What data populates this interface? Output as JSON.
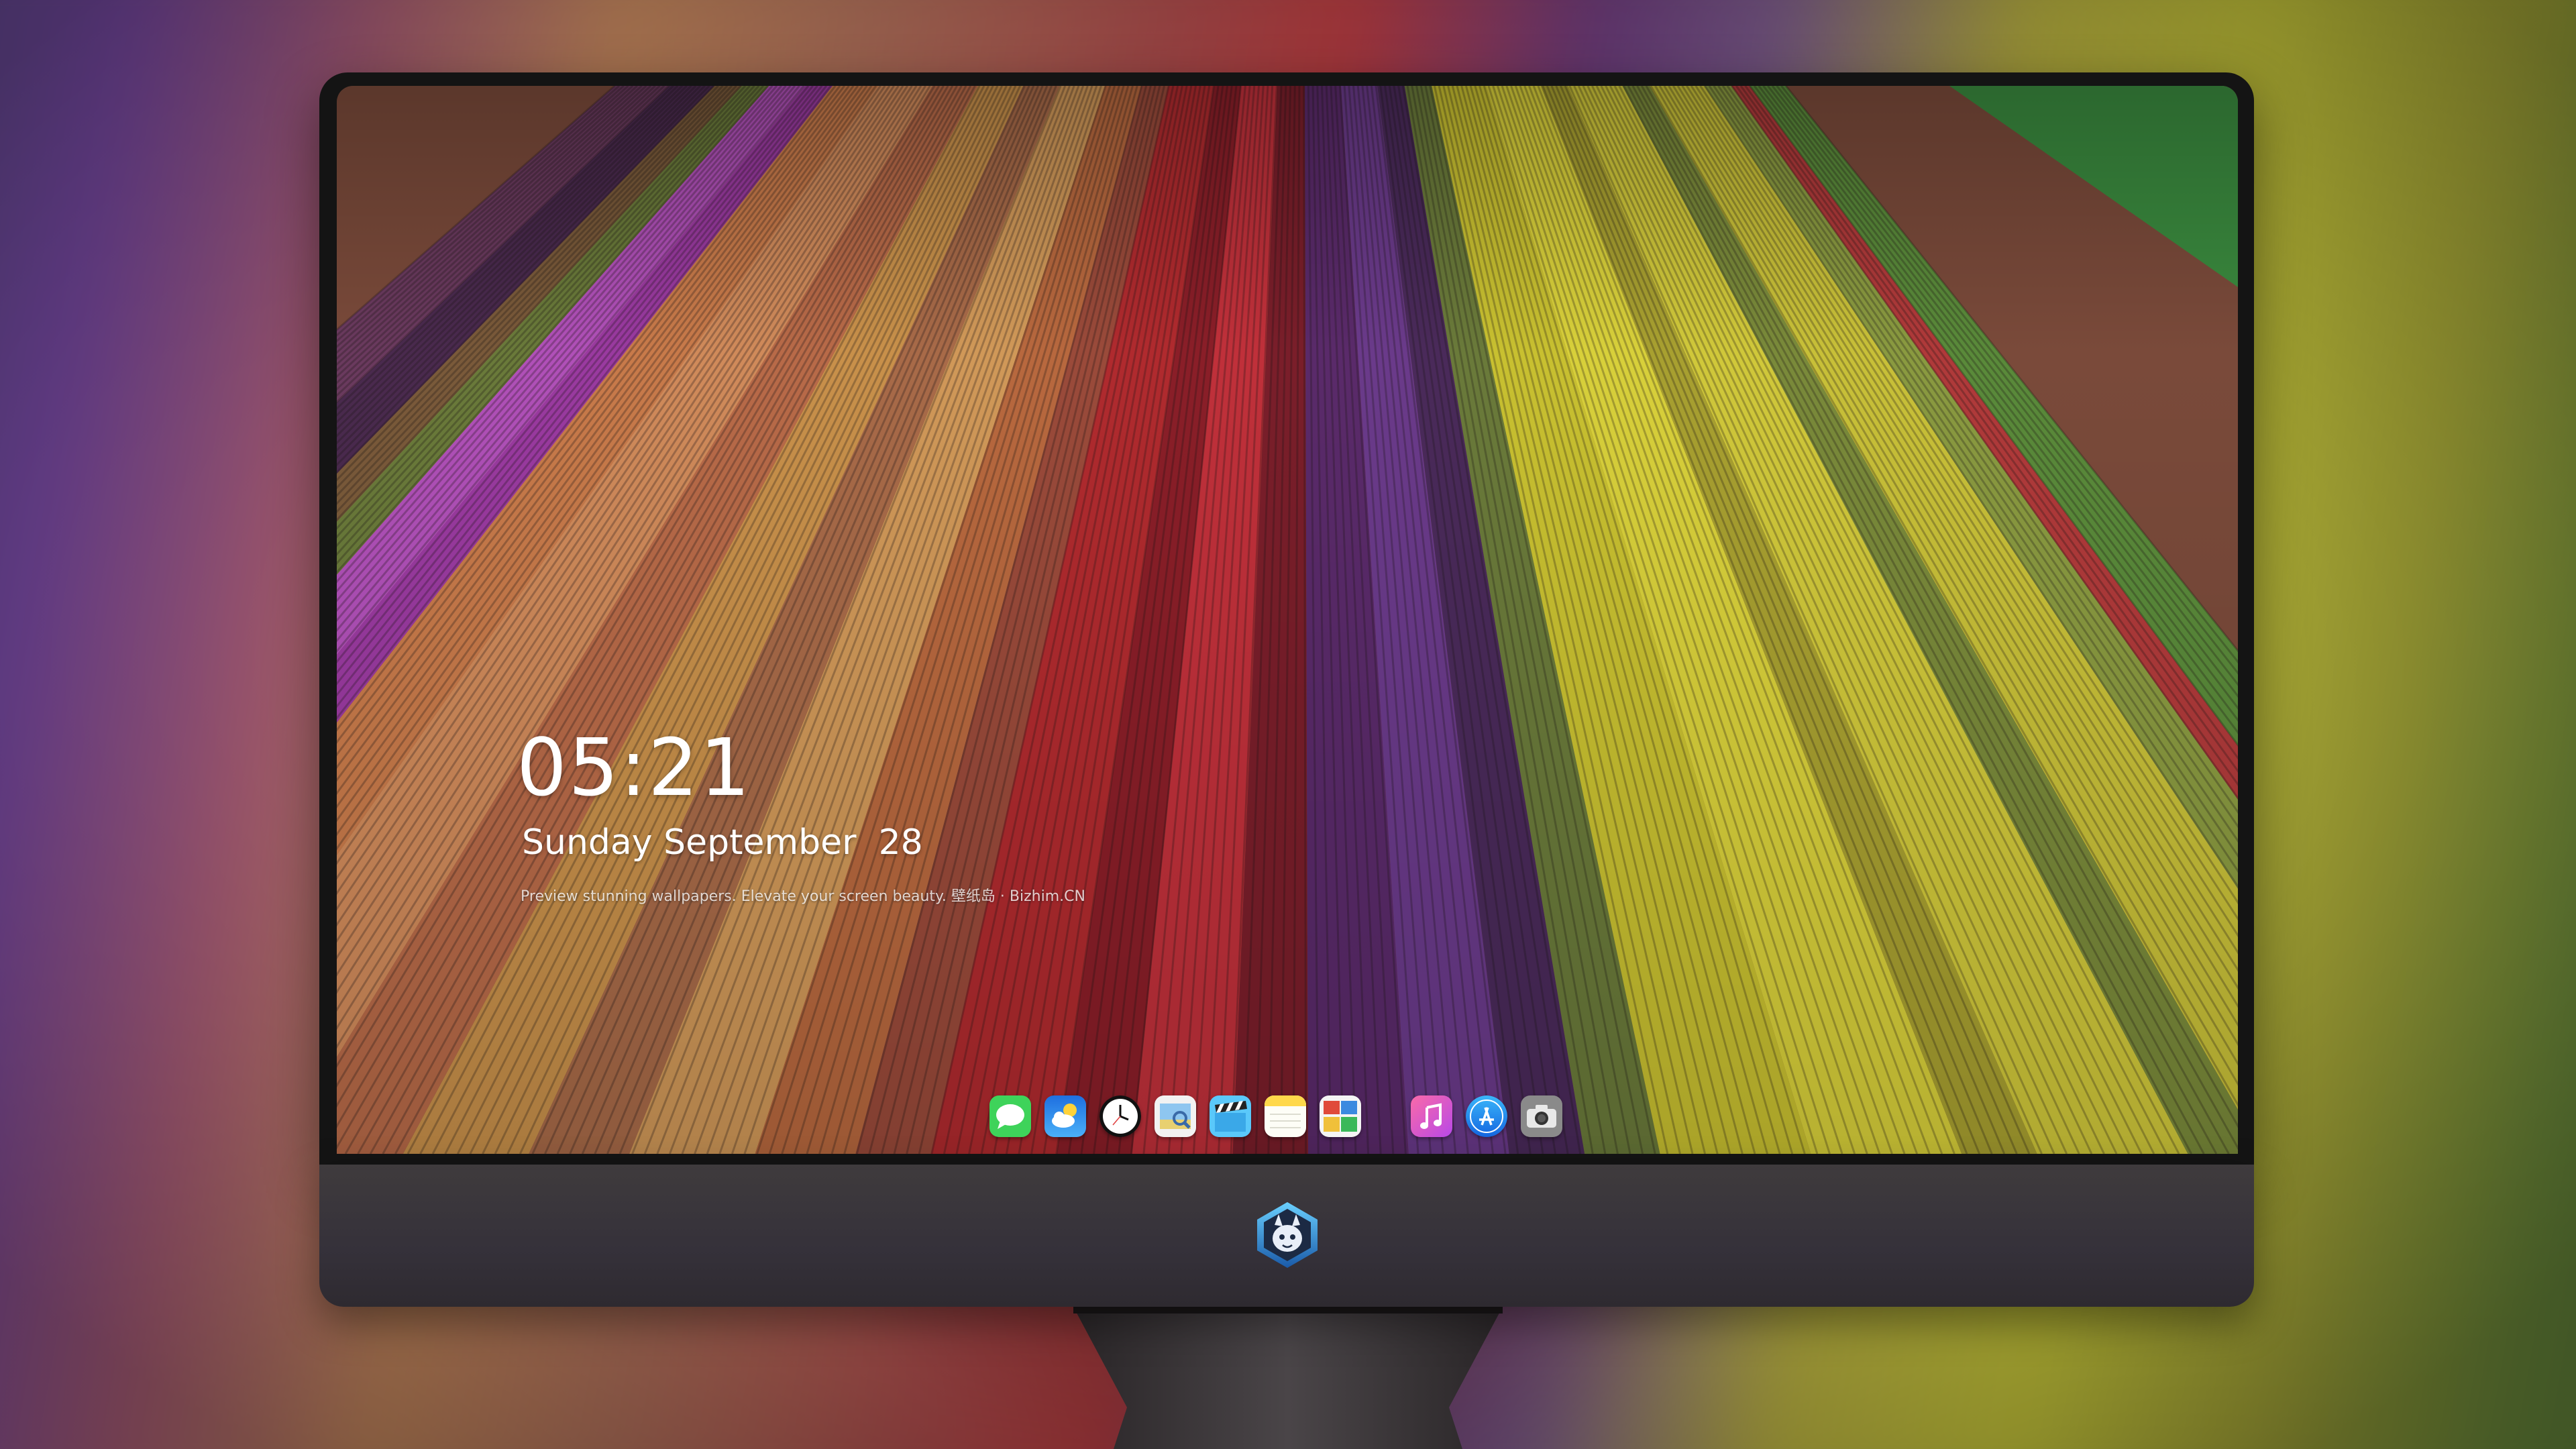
{
  "lockscreen": {
    "time": "05:21",
    "date": "Sunday September  28",
    "tagline": "Preview stunning wallpapers. Elevate your screen beauty. 壁纸岛 · Bizhim.CN"
  },
  "dock": {
    "apps": [
      {
        "name": "Messages",
        "icon": "messages-icon",
        "color": "#3ed35a"
      },
      {
        "name": "Weather",
        "icon": "weather-icon",
        "color": "#2f8ef0"
      },
      {
        "name": "Clock",
        "icon": "clock-icon",
        "color": "#111111"
      },
      {
        "name": "Preview",
        "icon": "preview-icon",
        "color": "#e8d070"
      },
      {
        "name": "Clips",
        "icon": "clapperboard-icon",
        "color": "#5ac8fa"
      },
      {
        "name": "Notes",
        "icon": "notes-icon",
        "color": "#ffd84a"
      },
      {
        "name": "Photo Booth",
        "icon": "photo-booth-icon",
        "color": "#e04a3a"
      },
      {
        "name": "iTunes",
        "icon": "music-icon",
        "color": "#e85bd8"
      },
      {
        "name": "App Store",
        "icon": "app-store-icon",
        "color": "#1d8cf0"
      },
      {
        "name": "Camera",
        "icon": "camera-icon",
        "color": "#8a8a8a"
      }
    ]
  },
  "colors": {
    "bezel": "#141414",
    "chin": "#3a3639",
    "text": "#ffffff"
  }
}
